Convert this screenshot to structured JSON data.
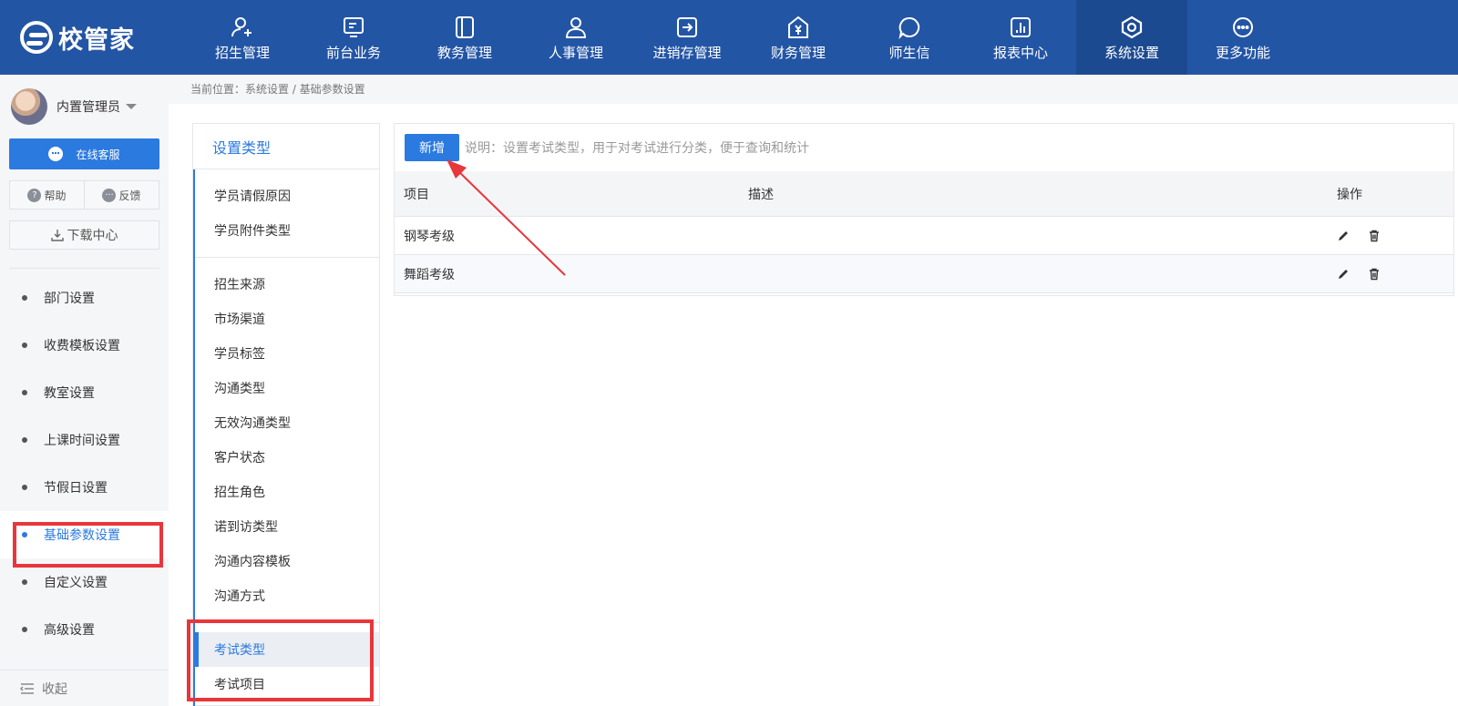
{
  "app": {
    "logo_text": "校管家"
  },
  "topnav": [
    {
      "label": "招生管理",
      "icon": "user-add-icon"
    },
    {
      "label": "前台业务",
      "icon": "monitor-icon"
    },
    {
      "label": "教务管理",
      "icon": "book-icon"
    },
    {
      "label": "人事管理",
      "icon": "person-icon"
    },
    {
      "label": "进销存管理",
      "icon": "inventory-icon"
    },
    {
      "label": "财务管理",
      "icon": "finance-icon"
    },
    {
      "label": "师生信",
      "icon": "chat-icon"
    },
    {
      "label": "报表中心",
      "icon": "report-icon"
    },
    {
      "label": "系统设置",
      "icon": "settings-icon",
      "active": true
    },
    {
      "label": "更多功能",
      "icon": "more-icon"
    }
  ],
  "sidebar": {
    "user_name": "内置管理员",
    "service_label": "在线客服",
    "help_label": "帮助",
    "feedback_label": "反馈",
    "download_label": "下载中心",
    "items": [
      {
        "label": "部门设置"
      },
      {
        "label": "收费模板设置"
      },
      {
        "label": "教室设置"
      },
      {
        "label": "上课时间设置"
      },
      {
        "label": "节假日设置"
      },
      {
        "label": "基础参数设置",
        "active": true
      },
      {
        "label": "自定义设置"
      },
      {
        "label": "高级设置"
      }
    ],
    "collapse_label": "收起"
  },
  "breadcrumb": "当前位置：系统设置 / 基础参数设置",
  "settings_types": {
    "header": "设置类型",
    "groups": [
      [
        "学员请假原因",
        "学员附件类型"
      ],
      [
        "招生来源",
        "市场渠道",
        "学员标签",
        "沟通类型",
        "无效沟通类型",
        "客户状态",
        "招生角色",
        "诺到访类型",
        "沟通内容模板",
        "沟通方式"
      ],
      [
        "考试类型",
        "考试项目"
      ]
    ],
    "active": "考试类型"
  },
  "main": {
    "add_label": "新增",
    "note": "说明：设置考试类型，用于对考试进行分类，便于查询和统计",
    "columns": [
      "项目",
      "描述",
      "操作"
    ],
    "rows": [
      {
        "item": "钢琴考级",
        "desc": ""
      },
      {
        "item": "舞蹈考级",
        "desc": ""
      }
    ]
  },
  "colors": {
    "primary": "#2b7ae0",
    "topbar": "#2355a5",
    "highlight": "#e8363b"
  }
}
